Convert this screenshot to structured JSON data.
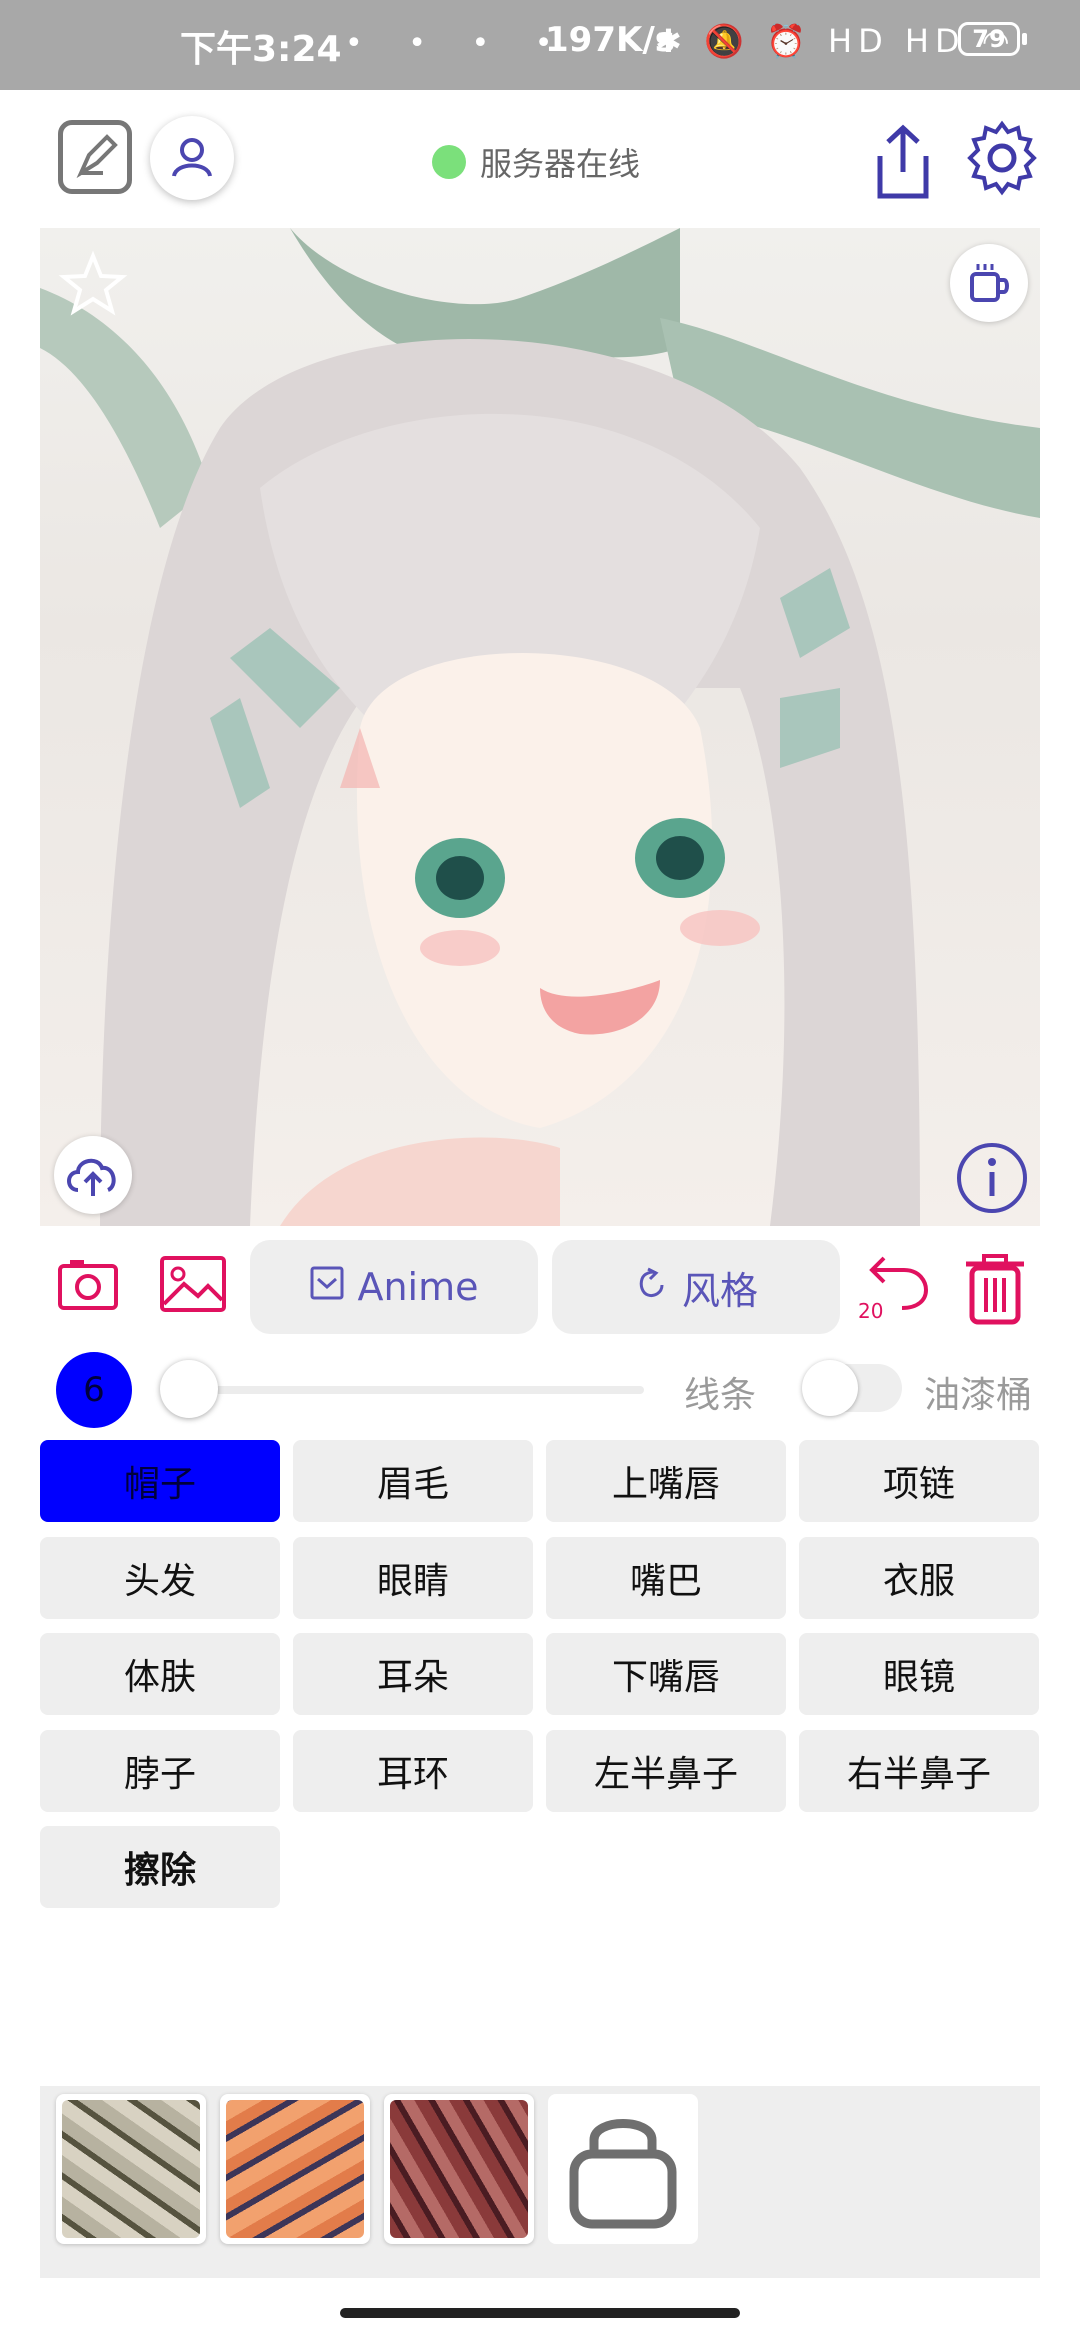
{
  "status_bar": {
    "time": "下午3:24",
    "dots": "• • • •",
    "speed": "197K/s",
    "icons": "✱ 🔕 ⏰ HD HD ◠",
    "battery": "79"
  },
  "header": {
    "server_status": "服务器在线",
    "server_status_color": "#7be07b"
  },
  "toolbar": {
    "anime_label": "Anime",
    "style_label": "风格",
    "undo_count": "20",
    "accent_color": "#e0115f",
    "pill_text_color": "#5a55b8"
  },
  "brush": {
    "size": "6",
    "slider_fraction": 0.0,
    "lines_label": "线条",
    "bucket_label": "油漆桶",
    "bucket_enabled": false
  },
  "labels": [
    {
      "text": "帽子",
      "active": true
    },
    {
      "text": "眉毛"
    },
    {
      "text": "上嘴唇"
    },
    {
      "text": "项链"
    },
    {
      "text": "头发"
    },
    {
      "text": "眼睛"
    },
    {
      "text": "嘴巴"
    },
    {
      "text": "衣服"
    },
    {
      "text": "体肤"
    },
    {
      "text": "耳朵"
    },
    {
      "text": "下嘴唇"
    },
    {
      "text": "眼镜"
    },
    {
      "text": "脖子"
    },
    {
      "text": "耳环"
    },
    {
      "text": "左半鼻子"
    },
    {
      "text": "右半鼻子"
    },
    {
      "text": "擦除",
      "bold": true
    }
  ],
  "textures": [
    "texture-beige",
    "texture-orange",
    "texture-maroon"
  ]
}
